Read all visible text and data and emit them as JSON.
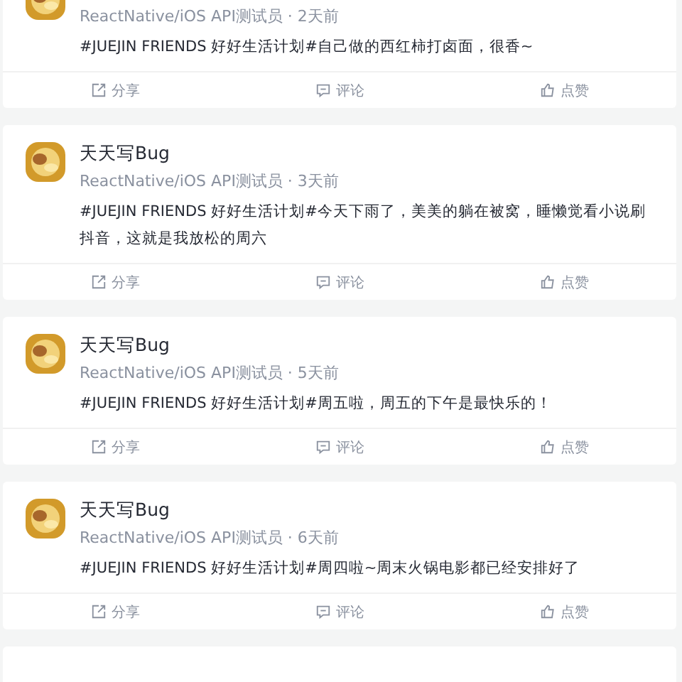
{
  "posts": [
    {
      "meta": "ReactNative/iOS API测试员 · 2天前",
      "content": "#JUEJIN FRIENDS 好好生活计划#自己做的西红柿打卤面，很香~",
      "actions": [
        "分享",
        "评论",
        "点赞"
      ]
    },
    {
      "author": "天天写Bug",
      "meta": "ReactNative/iOS API测试员 · 3天前",
      "content": "#JUEJIN FRIENDS 好好生活计划#今天下雨了，美美的躺在被窝，睡懒觉看小说刷抖音，这就是我放松的周六",
      "actions": [
        "分享",
        "评论",
        "点赞"
      ]
    },
    {
      "author": "天天写Bug",
      "meta": "ReactNative/iOS API测试员 · 5天前",
      "content": "#JUEJIN FRIENDS 好好生活计划#周五啦，周五的下午是最快乐的！",
      "actions": [
        "分享",
        "评论",
        "点赞"
      ]
    },
    {
      "author": "天天写Bug",
      "meta": "ReactNative/iOS API测试员 · 6天前",
      "content": "#JUEJIN FRIENDS 好好生活计划#周四啦~周末火锅电影都已经安排好了",
      "actions": [
        "分享",
        "评论",
        "点赞"
      ]
    }
  ]
}
